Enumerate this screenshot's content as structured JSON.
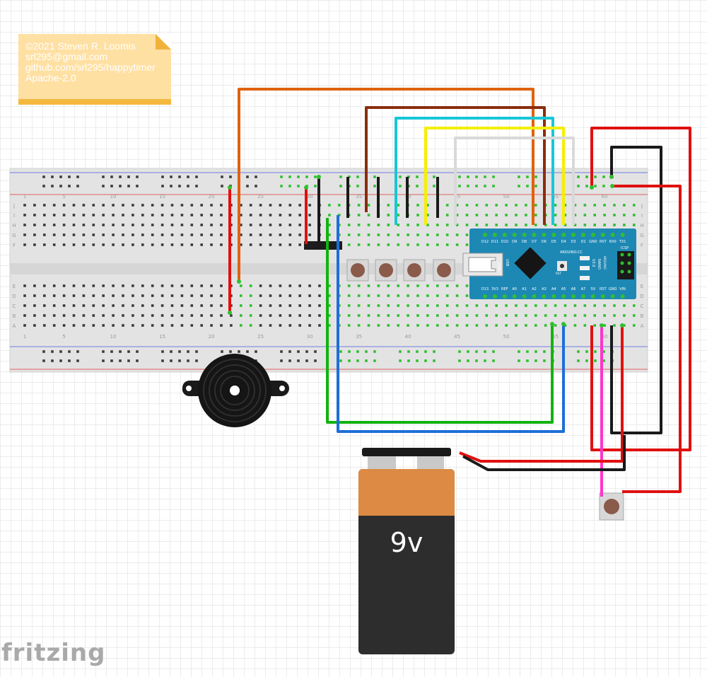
{
  "note": {
    "lines": [
      "©2021 Steven R. Loomis",
      "srl295@gmail.com",
      "github.com/srl295/happytimer",
      "Apache-2.0"
    ]
  },
  "breadboard": {
    "column_numbers": [
      "1",
      "5",
      "10",
      "15",
      "20",
      "25",
      "30",
      "35",
      "40",
      "45",
      "50",
      "55",
      "60"
    ],
    "row_letters_top": [
      "J",
      "I",
      "H",
      "G",
      "F"
    ],
    "row_letters_bottom": [
      "E",
      "D",
      "C",
      "B",
      "A"
    ]
  },
  "arduino": {
    "top_pins": [
      "D12",
      "D11",
      "D10",
      "D9",
      "D8",
      "D7",
      "D6",
      "D5",
      "D4",
      "D3",
      "D2",
      "GND",
      "RST",
      "RX0",
      "TX1"
    ],
    "bottom_pins": [
      "D13",
      "3V3",
      "REF",
      "A0",
      "A1",
      "A2",
      "A3",
      "A4",
      "A5",
      "A6",
      "A7",
      "5V",
      "RST",
      "GND",
      "VIN"
    ],
    "brand": "ARDUINO.CC",
    "model": "NANO",
    "version": "V3.0",
    "side_text": "ARDUINO",
    "usb_label": "USB",
    "year": "2009",
    "rst_label": "RST",
    "icsp_label": "ICSP"
  },
  "battery": {
    "label": "9v"
  },
  "logo": {
    "text": "fritzing"
  },
  "colors": {
    "wire_red": "#e01010",
    "wire_black": "#1a1a1a",
    "wire_orange": "#e0620e",
    "wire_brown": "#8b2d0c",
    "wire_cyan": "#17c7d6",
    "wire_yellow": "#f4ef00",
    "wire_white": "#d9d9d9",
    "wire_green": "#12b30f",
    "wire_blue": "#1f6fd8",
    "wire_magenta": "#ff33cc",
    "board_blue": "#1e88b5",
    "battery_orange": "#dc8a44"
  }
}
